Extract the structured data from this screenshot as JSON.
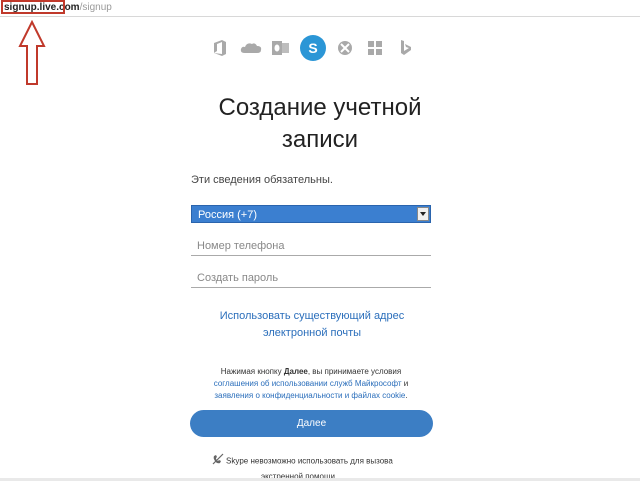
{
  "browser": {
    "url_domain": "signup.live.com",
    "url_path": "/signup"
  },
  "product_icons": [
    "office-icon",
    "onedrive-icon",
    "outlook-icon",
    "skype-icon",
    "xbox-icon",
    "windows-icon",
    "bing-icon"
  ],
  "signup": {
    "title": "Создание учетной записи",
    "required_note": "Эти сведения обязательны.",
    "country_select_value": "Россия (+7)",
    "phone_placeholder": "Номер телефона",
    "password_placeholder": "Создать пароль",
    "use_email_link": "Использовать существующий адрес электронной почты",
    "terms_prefix": "Нажимая кнопку ",
    "terms_bold": "Далее",
    "terms_middle": ", вы принимаете условия",
    "terms_link1": "соглашения об использовании служб Майкрософт",
    "terms_and": " и",
    "terms_link2": "заявления о конфиденциальности и файлах cookie",
    "terms_end": ".",
    "next_button": "Далее",
    "skype_note_line1": "Skype невозможно использовать для вызова",
    "skype_note_line2": "экстренной помощи."
  },
  "colors": {
    "accent": "#3c7ec4",
    "link": "#2a6ebb",
    "highlight": "#c0392b"
  }
}
